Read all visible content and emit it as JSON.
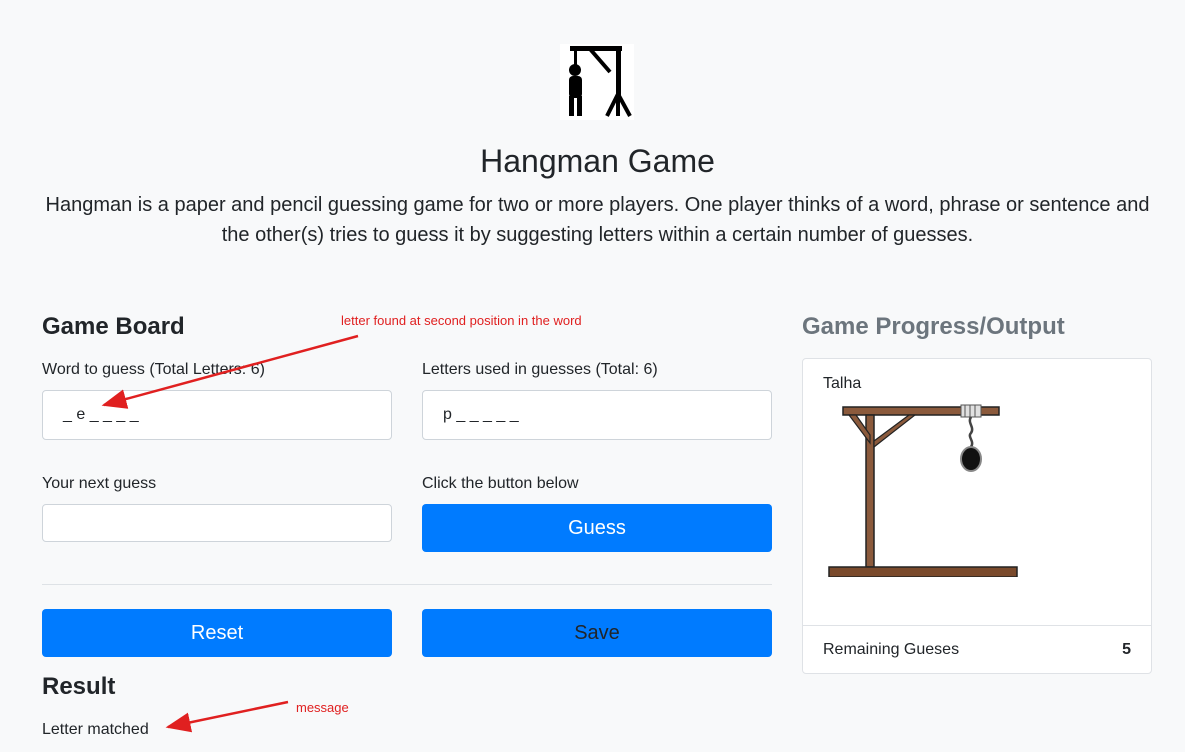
{
  "header": {
    "title": "Hangman Game",
    "intro": "Hangman is a paper and pencil guessing game for two or more players. One player thinks of a word, phrase or sentence and the other(s) tries to guess it by suggesting letters within a certain number of guesses."
  },
  "board": {
    "heading": "Game Board",
    "word_label": "Word to guess (Total Letters: 6)",
    "word_value": "_ e _ _ _ _",
    "letters_label": "Letters used in guesses (Total: 6)",
    "letters_value": "p _ _ _ _ _",
    "guess_label": "Your next guess",
    "guess_value": "",
    "guess_placeholder": "",
    "button_hint_label": "Click the button below",
    "guess_button": "Guess",
    "reset_button": "Reset",
    "save_button": "Save"
  },
  "result": {
    "heading": "Result",
    "message": "Letter matched"
  },
  "progress": {
    "heading": "Game Progress/Output",
    "player": "Talha",
    "remaining_label": "Remaining Gueses",
    "remaining_count": "5"
  },
  "annotations": {
    "word_note": "letter found at second position in the word",
    "message_note": "message"
  },
  "colors": {
    "primary": "#007bff",
    "annotation": "#e02020",
    "wood": "#8b5a3c"
  },
  "icons": [
    "hangman-logo-icon",
    "gallows-icon"
  ]
}
